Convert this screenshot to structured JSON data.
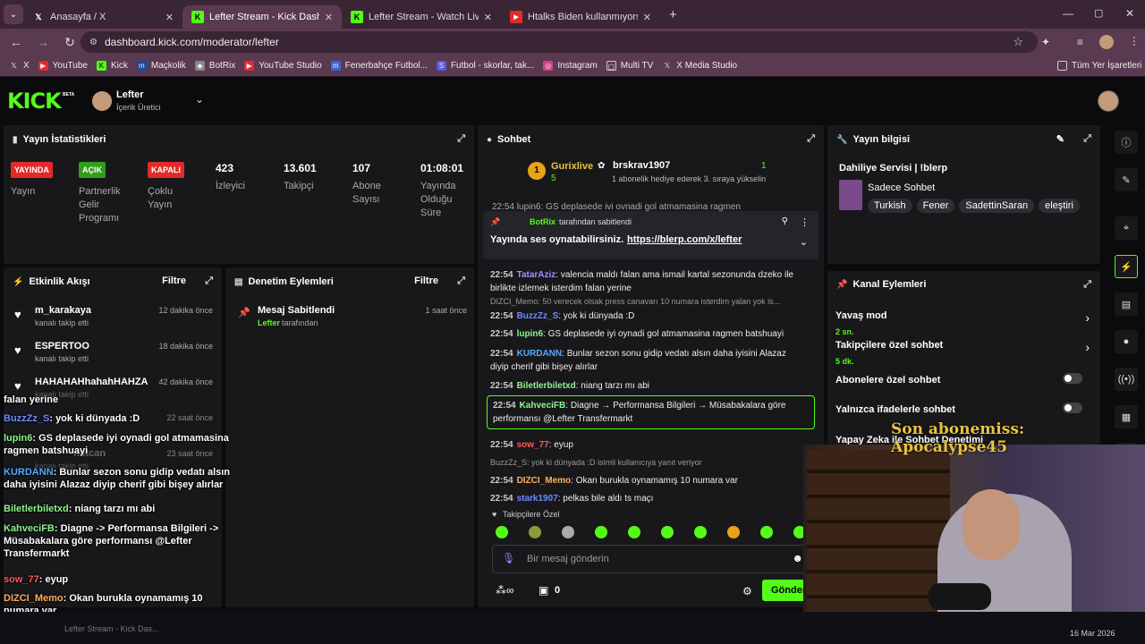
{
  "tabs": [
    {
      "label": "Anasayfa / X",
      "icon": "X"
    },
    {
      "label": "Lefter Stream - Kick Dashboard",
      "icon": "K"
    },
    {
      "label": "Lefter Stream - Watch Live on K",
      "icon": "K"
    },
    {
      "label": "Htalks Biden kullanmıyorsanız",
      "icon": "▶"
    }
  ],
  "address": "dashboard.kick.com/moderator/lefter",
  "bookmarks": [
    "X",
    "YouTube",
    "Kick",
    "Maçkolik",
    "BotRix",
    "YouTube Studio",
    "Fenerbahçe Futbol...",
    "Futbol - skorlar, tak...",
    "Instagram",
    "Multi TV",
    "X Media Studio"
  ],
  "all_bookmarks": "Tüm Yer İşaretleri",
  "brand": "KICK",
  "brand_beta": "BETA",
  "user": {
    "name": "Lefter",
    "role": "İçerik Üretici"
  },
  "stats": {
    "title": "Yayın İstatistikleri",
    "badges": [
      {
        "badge": "YAYINDA",
        "label": "Yayın",
        "color": "#e32a2a"
      },
      {
        "badge": "AÇIK",
        "label": "Partnerlik Gelir Programı",
        "color": "#2f9e1d"
      },
      {
        "badge": "KAPALI",
        "label": "Çoklu Yayın",
        "color": "#e32a2a"
      }
    ],
    "numbers": [
      {
        "value": "423",
        "label": "İzleyici"
      },
      {
        "value": "13.601",
        "label": "Takipçi"
      },
      {
        "value": "107",
        "label": "Abone Sayısı"
      },
      {
        "value": "01:08:01",
        "label": "Yayında Olduğu Süre"
      }
    ]
  },
  "activity": {
    "title": "Etkinlik Akışı",
    "filter": "Filtre",
    "items": [
      {
        "name": "m_karakaya",
        "desc": "kanalı takip etti",
        "time": "12 dakika önce"
      },
      {
        "name": "ESPERTOO",
        "desc": "kanalı takip etti",
        "time": "18 dakika önce"
      },
      {
        "name": "HAHAHAHhahahHAHZA",
        "desc": "kanalı takip etti",
        "time": "42 dakika önce"
      },
      {
        "name": "",
        "desc": "",
        "time": "22 saat önce"
      },
      {
        "name": "nutcan",
        "desc": "kanalı takip etti",
        "time": "23 saat önce"
      }
    ]
  },
  "moderation": {
    "title": "Denetim Eylemleri",
    "filter": "Filtre",
    "items": [
      {
        "name": "Mesaj Sabitlendi",
        "user": "Lefter",
        "suffix": "tarafından",
        "time": "1 saat önce"
      }
    ]
  },
  "chat": {
    "title": "Sohbet",
    "top_gifter": "Gurixlive",
    "top_gifter_count": "5",
    "top_gifter_rank": "1",
    "gift_user": "brskrav1907",
    "gift_count": "1",
    "gift_text": "1 abonelik hediye ederek 3. sıraya yükselin",
    "pinned": {
      "by": "BotRix",
      "by_suffix": "tarafından sabitlendi",
      "text": "Yayında ses oynatabilirsiniz.",
      "link": "https://blerp.com/x/lefter"
    },
    "scroll_top": "22:54 lupin6: GS deplasede ivi ovnadi gol atmamasina ragmen",
    "messages": [
      {
        "ts": "22:54",
        "user": "TatarAziz",
        "color": "#a68dff",
        "text": ": valencia maldı falan ama ismail kartal sezonunda dzeko ile birlikte izlemek isterdim falan yerine"
      },
      {
        "reply": "DIZCI_Memo: 50 verecek olsak press canavarı 10 numara isterdim yalan yok is..."
      },
      {
        "ts": "22:54",
        "user": "BuzzZz_S",
        "color": "#6b8cff",
        "text": ": yok ki dünyada :D"
      },
      {
        "ts": "22:54",
        "user": "lupin6",
        "color": "#8ef58e",
        "text": ": GS deplasede iyi oynadi gol atmamasina ragmen batshuayi"
      },
      {
        "ts": "22:54",
        "user": "KURDANN",
        "color": "#5aa8ff",
        "text": ": Bunlar sezon sonu gidip vedatı alsın daha iyisini Alazaz diyip cherif gibi bişey alırlar"
      },
      {
        "ts": "22:54",
        "user": "Biletlerbiletxd",
        "color": "#8ef58e",
        "text": ": niang tarzı mı abi"
      },
      {
        "ts": "22:54",
        "user": "KahveciFB",
        "color": "#8ef58e",
        "text": ": Diagne → Performansa Bilgileri → Müsabakalara göre performansı @Lefter Transfermarkt",
        "highlight": true
      },
      {
        "ts": "22:54",
        "user": "sow_77",
        "color": "#ff5a5a",
        "text": ": eyup"
      },
      {
        "reply": "BuzzZz_S: yok ki dünyada :D isimli kullanıcıya yanıt veriyor"
      },
      {
        "ts": "22:54",
        "user": "DIZCI_Memo",
        "color": "#ffb060",
        "text": ": Okan burukla oynamamış 10 numara var"
      },
      {
        "ts": "22:54",
        "user": "stark1907",
        "color": "#6b8cff",
        "text": ": pelkas bile aldı ts maçı"
      }
    ],
    "followers_only": "Takipçilere Özel",
    "placeholder": "Bir mesaj gönderin",
    "send": "Gönder",
    "points": "0"
  },
  "info": {
    "title": "Yayın bilgisi",
    "stream_title": "Dahiliye Servisi | !blerp",
    "category": "Sadece Sohbet",
    "tags": [
      "Turkish",
      "Fener",
      "SadettinSaran",
      "eleştiri"
    ]
  },
  "channel": {
    "title": "Kanal Eylemleri",
    "items": [
      {
        "label": "Yavaş mod",
        "sub": "2 sn.",
        "type": "arrow"
      },
      {
        "label": "Takipçilere özel sohbet",
        "sub": "5 dk.",
        "type": "arrow"
      },
      {
        "label": "Abonelere özel sohbet",
        "sub": "",
        "type": "toggle"
      },
      {
        "label": "Yalnızca ifadelerle sohbet",
        "sub": "",
        "type": "toggle"
      },
      {
        "label": "Yapay Zeka ile Sohbet Denetimi",
        "sub": "",
        "type": "toggle"
      }
    ]
  },
  "overlay": {
    "sub_banner": "Son abonemiss: Apocalypse45",
    "lines": [
      {
        "user": "",
        "text": "falan yerine",
        "color": "#ffffff"
      },
      {
        "user": "BuzzZz_S",
        "text": ": yok ki dünyada :D",
        "color": "#6b8cff"
      },
      {
        "user": "lupin6",
        "text": ": GS deplasede iyi oynadi gol atmamasina ragmen batshuayi",
        "color": "#8ef58e"
      },
      {
        "user": "KURDANN",
        "text": ": Bunlar sezon sonu gidip vedatı alsın daha iyisini Alazaz diyip cherif gibi bişey alırlar",
        "color": "#5aa8ff"
      },
      {
        "user": "Biletlerbiletxd",
        "text": ": niang tarzı mı abi",
        "color": "#8ef58e"
      },
      {
        "user": "KahveciFB",
        "text": ": Diagne -> Performansa Bilgileri -> Müsabakalara göre performansı @Lefter Transfermarkt",
        "color": "#8ef58e"
      },
      {
        "user": "sow_77",
        "text": ": eyup",
        "color": "#ff5a5a"
      },
      {
        "user": "DIZCI_Memo",
        "text": ": Okan burukla oynamamış 10 numara var",
        "color": "#ffb060"
      },
      {
        "user": "stark1907",
        "text": ": pelkas bile aldı ts maçı",
        "color": "#6b8cff"
      }
    ]
  },
  "taskbar": {
    "date": "16 Mar 2026",
    "window": "Lefter Stream - Kick Das..."
  },
  "colors": {
    "kick_green": "#53fc18",
    "panel": "#18181b",
    "bg": "#0b0b0d"
  }
}
